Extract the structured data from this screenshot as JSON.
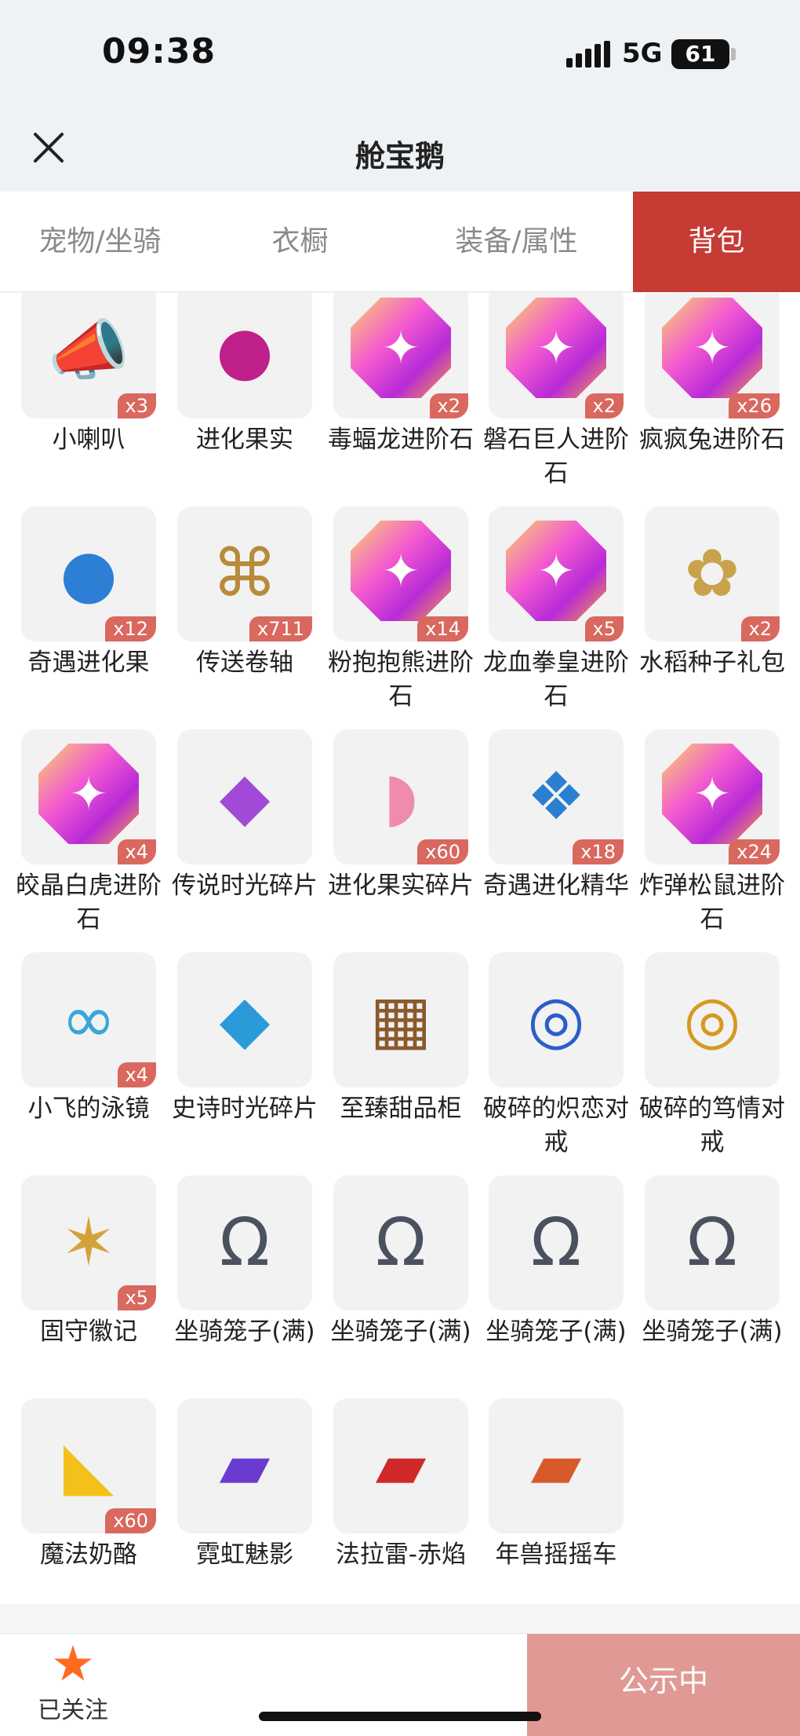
{
  "status": {
    "time": "09:38",
    "network": "5G",
    "battery": "61"
  },
  "nav": {
    "title": "舱宝鹅",
    "close_icon": "close-icon"
  },
  "tabs": [
    {
      "label": "宠物/坐骑",
      "active": false
    },
    {
      "label": "衣橱",
      "active": false
    },
    {
      "label": "装备/属性",
      "active": false
    },
    {
      "label": "背包",
      "active": true
    }
  ],
  "items": [
    {
      "label": "小喇叭",
      "count": "x3",
      "icon": "megaphone-icon"
    },
    {
      "label": "进化果实",
      "count": "",
      "icon": "evolution-fruit-icon"
    },
    {
      "label": "毒蝠龙进阶石",
      "count": "x2",
      "icon": "advance-stone-icon"
    },
    {
      "label": "磐石巨人进阶石",
      "count": "x2",
      "icon": "advance-stone-icon"
    },
    {
      "label": "疯疯兔进阶石",
      "count": "x26",
      "icon": "advance-stone-icon"
    },
    {
      "label": "奇遇进化果",
      "count": "x12",
      "icon": "adventure-fruit-icon"
    },
    {
      "label": "传送卷轴",
      "count": "x711",
      "icon": "scroll-icon"
    },
    {
      "label": "粉抱抱熊进阶石",
      "count": "x14",
      "icon": "advance-stone-icon"
    },
    {
      "label": "龙血拳皇进阶石",
      "count": "x5",
      "icon": "advance-stone-icon"
    },
    {
      "label": "水稻种子礼包",
      "count": "x2",
      "icon": "seed-pack-icon"
    },
    {
      "label": "皎晶白虎进阶石",
      "count": "x4",
      "icon": "advance-stone-icon"
    },
    {
      "label": "传说时光碎片",
      "count": "",
      "icon": "legend-fragment-icon"
    },
    {
      "label": "进化果实碎片",
      "count": "x60",
      "icon": "fruit-fragment-icon"
    },
    {
      "label": "奇遇进化精华",
      "count": "x18",
      "icon": "essence-icon"
    },
    {
      "label": "炸弹松鼠进阶石",
      "count": "x24",
      "icon": "advance-stone-icon"
    },
    {
      "label": "小飞的泳镜",
      "count": "x4",
      "icon": "goggles-icon"
    },
    {
      "label": "史诗时光碎片",
      "count": "",
      "icon": "epic-fragment-icon"
    },
    {
      "label": "至臻甜品柜",
      "count": "",
      "icon": "dessert-cabinet-icon"
    },
    {
      "label": "破碎的炽恋对戒",
      "count": "",
      "icon": "blue-ring-icon"
    },
    {
      "label": "破碎的笃情对戒",
      "count": "",
      "icon": "gold-ring-icon"
    },
    {
      "label": "固守徽记",
      "count": "x5",
      "icon": "emblem-icon"
    },
    {
      "label": "坐骑笼子(满)",
      "count": "",
      "icon": "mount-cage-icon"
    },
    {
      "label": "坐骑笼子(满)",
      "count": "",
      "icon": "mount-cage-icon"
    },
    {
      "label": "坐骑笼子(满)",
      "count": "",
      "icon": "mount-cage-icon"
    },
    {
      "label": "坐骑笼子(满)",
      "count": "",
      "icon": "mount-cage-icon"
    },
    {
      "label": "魔法奶酪",
      "count": "x60",
      "icon": "cheese-icon"
    },
    {
      "label": "霓虹魅影",
      "count": "",
      "icon": "neon-kart-icon"
    },
    {
      "label": "法拉雷-赤焰",
      "count": "",
      "icon": "red-car-icon"
    },
    {
      "label": "年兽摇摇车",
      "count": "",
      "icon": "nian-kart-icon"
    }
  ],
  "bottom": {
    "follow_label": "已关注",
    "publish_label": "公示中"
  },
  "colors": {
    "accent": "#c63b33",
    "badge": "#d9685f",
    "publish": "#e09994",
    "star": "#ff6a1f"
  }
}
